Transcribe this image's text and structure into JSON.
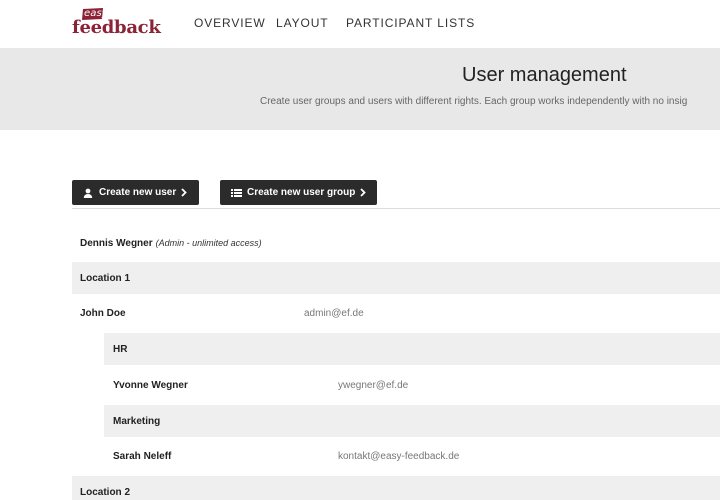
{
  "brand": {
    "small": "easy",
    "word": "feedback",
    "color": "#8c2235"
  },
  "nav": {
    "items": [
      {
        "label": "OVERVIEW"
      },
      {
        "label": "LAYOUT"
      },
      {
        "label": "PARTICIPANT LISTS"
      }
    ]
  },
  "header": {
    "title": "User management",
    "subtitle": "Create user groups and users with different rights. Each group works independently with no insig"
  },
  "actions": {
    "create_user": {
      "label": "Create new user",
      "icon": "user-icon"
    },
    "create_group": {
      "label": "Create new user group",
      "icon": "list-icon"
    }
  },
  "users": {
    "admin": {
      "name": "Dennis Wegner",
      "note": "(Admin - unlimited access)"
    },
    "locations": [
      {
        "name": "Location 1",
        "manager": {
          "name": "John Doe",
          "email": "admin@ef.de"
        },
        "groups": [
          {
            "name": "HR",
            "members": [
              {
                "name": "Yvonne Wegner",
                "email": "ywegner@ef.de"
              }
            ]
          },
          {
            "name": "Marketing",
            "members": [
              {
                "name": "Sarah Neleff",
                "email": "kontakt@easy-feedback.de"
              }
            ]
          }
        ]
      },
      {
        "name": "Location 2"
      }
    ]
  }
}
